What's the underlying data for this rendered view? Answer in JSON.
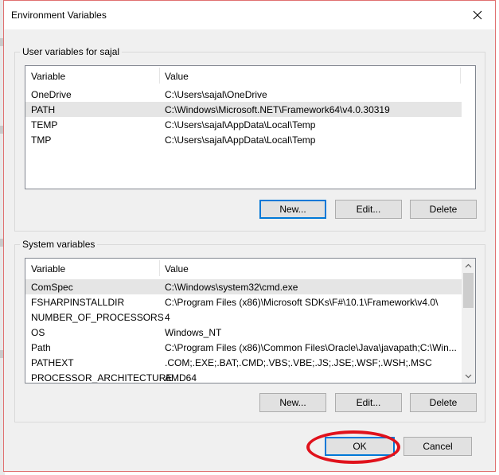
{
  "dialog": {
    "title": "Environment Variables",
    "close_icon": "close-icon"
  },
  "user_vars": {
    "group_label": "User variables for sajal",
    "columns": [
      "Variable",
      "Value"
    ],
    "rows": [
      {
        "variable": "OneDrive",
        "value": "C:\\Users\\sajal\\OneDrive"
      },
      {
        "variable": "PATH",
        "value": "C:\\Windows\\Microsoft.NET\\Framework64\\v4.0.30319"
      },
      {
        "variable": "TEMP",
        "value": "C:\\Users\\sajal\\AppData\\Local\\Temp"
      },
      {
        "variable": "TMP",
        "value": "C:\\Users\\sajal\\AppData\\Local\\Temp"
      }
    ],
    "selected_row": 1,
    "new_label": "New...",
    "edit_label": "Edit...",
    "delete_label": "Delete"
  },
  "system_vars": {
    "group_label": "System variables",
    "columns": [
      "Variable",
      "Value"
    ],
    "rows": [
      {
        "variable": "ComSpec",
        "value": "C:\\Windows\\system32\\cmd.exe"
      },
      {
        "variable": "FSHARPINSTALLDIR",
        "value": "C:\\Program Files (x86)\\Microsoft SDKs\\F#\\10.1\\Framework\\v4.0\\"
      },
      {
        "variable": "NUMBER_OF_PROCESSORS",
        "value": "4"
      },
      {
        "variable": "OS",
        "value": "Windows_NT"
      },
      {
        "variable": "Path",
        "value": "C:\\Program Files (x86)\\Common Files\\Oracle\\Java\\javapath;C:\\Win..."
      },
      {
        "variable": "PATHEXT",
        "value": ".COM;.EXE;.BAT;.CMD;.VBS;.VBE;.JS;.JSE;.WSF;.WSH;.MSC"
      },
      {
        "variable": "PROCESSOR_ARCHITECTURE",
        "value": "AMD64"
      }
    ],
    "selected_row": 0,
    "new_label": "New...",
    "edit_label": "Edit...",
    "delete_label": "Delete"
  },
  "footer": {
    "ok_label": "OK",
    "cancel_label": "Cancel"
  },
  "colors": {
    "highlight_ring": "#e0121c",
    "default_button_border": "#0078d7",
    "selection": "#e5e5e5"
  }
}
